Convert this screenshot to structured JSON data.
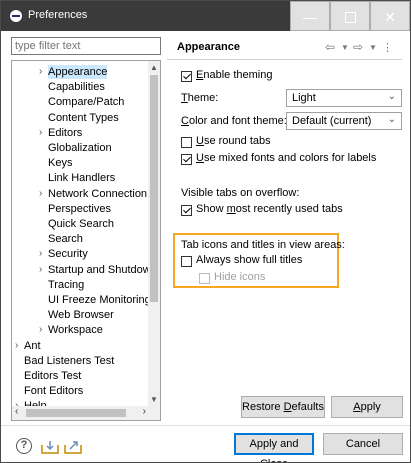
{
  "window": {
    "title": "Preferences",
    "minimize_glyph": "—",
    "close_glyph": "✕"
  },
  "filter": {
    "placeholder": "type filter text"
  },
  "tree": [
    {
      "label": "Appearance",
      "twisty": "›",
      "selected": true
    },
    {
      "label": "Capabilities",
      "twisty": ""
    },
    {
      "label": "Compare/Patch",
      "twisty": ""
    },
    {
      "label": "Content Types",
      "twisty": ""
    },
    {
      "label": "Editors",
      "twisty": "›"
    },
    {
      "label": "Globalization",
      "twisty": ""
    },
    {
      "label": "Keys",
      "twisty": ""
    },
    {
      "label": "Link Handlers",
      "twisty": ""
    },
    {
      "label": "Network Connection",
      "twisty": "›"
    },
    {
      "label": "Perspectives",
      "twisty": ""
    },
    {
      "label": "Quick Search",
      "twisty": ""
    },
    {
      "label": "Search",
      "twisty": ""
    },
    {
      "label": "Security",
      "twisty": "›"
    },
    {
      "label": "Startup and Shutdow",
      "twisty": "›"
    },
    {
      "label": "Tracing",
      "twisty": ""
    },
    {
      "label": "UI Freeze Monitoring",
      "twisty": ""
    },
    {
      "label": "Web Browser",
      "twisty": ""
    },
    {
      "label": "Workspace",
      "twisty": "›"
    },
    {
      "label": "Ant",
      "twisty": "›"
    },
    {
      "label": "Bad Listeners Test",
      "twisty": ""
    },
    {
      "label": "Editors Test",
      "twisty": ""
    },
    {
      "label": "Font Editors",
      "twisty": ""
    },
    {
      "label": "Help",
      "twisty": "›"
    }
  ],
  "page": {
    "title": "Appearance",
    "enable_theming": {
      "label_u": "E",
      "label_rest": "nable theming",
      "checked": true
    },
    "theme": {
      "label_u": "T",
      "label_rest": "heme:",
      "value": "Light"
    },
    "color_font_theme": {
      "label_u": "C",
      "label_rest": "olor and font theme:",
      "value": "Default (current)"
    },
    "round_tabs": {
      "label_u": "U",
      "label_rest": "se round tabs",
      "checked": false
    },
    "mixed_fonts": {
      "label_u": "U",
      "label_rest": "se mixed fonts and colors for labels",
      "checked": true
    },
    "visible_tabs_label": "Visible tabs on overflow:",
    "show_mru": {
      "label_pre": "Show ",
      "label_u": "m",
      "label_rest": "ost recently used tabs",
      "checked": true
    },
    "tab_icons_label": "Tab icons and titles in view areas:",
    "always_full_titles": {
      "label": "Always show full titles",
      "checked": false
    },
    "hide_icons": {
      "label": "Hide icons",
      "checked": false,
      "disabled": true
    }
  },
  "buttons": {
    "restore_u": "D",
    "restore_pre": "Restore ",
    "restore_rest": "efaults",
    "apply_u": "A",
    "apply_rest": "pply",
    "apply_close": "Apply and Close",
    "cancel": "Cancel"
  },
  "colors": {
    "highlight": "#f6a623",
    "selection": "#cce8ff",
    "titlebar": "#3a3a3a"
  }
}
